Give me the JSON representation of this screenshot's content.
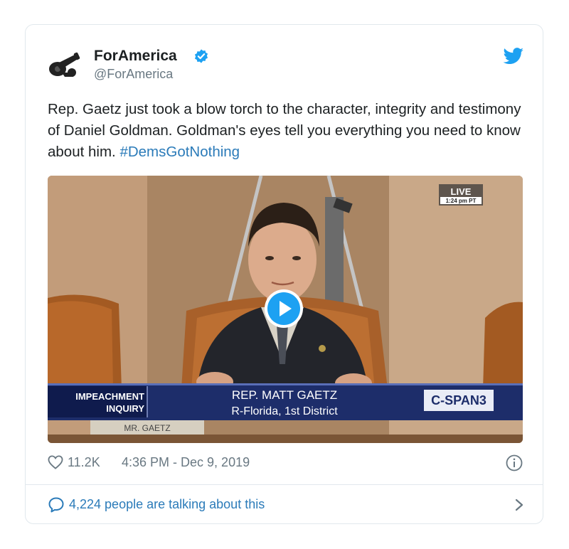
{
  "tweet": {
    "author_name": "ForAmerica",
    "author_handle": "@ForAmerica",
    "text_main": "Rep. Gaetz just took a blow torch to the character, integrity and testimony of Daniel Goldman. Goldman's eyes tell you everything you need to know about him.",
    "hashtag": "#DemsGotNothing",
    "likes": "11.2K",
    "timestamp": "4:36 PM - Dec 9, 2019",
    "talking": "4,224 people are talking about this"
  },
  "video": {
    "live_label": "LIVE",
    "live_time": "1:24 pm PT",
    "chyron_left_1": "IMPEACHMENT",
    "chyron_left_2": "INQUIRY",
    "chyron_name": "REP. MATT GAETZ",
    "chyron_district": "R-Florida, 1st District",
    "network_logo": "C-SPAN3",
    "nameplate": "MR. GAETZ"
  },
  "colors": {
    "link": "#2b7bb9",
    "muted": "#697882",
    "twitter_blue": "#1da1f2",
    "border": "#e1e8ed"
  },
  "icons": [
    "cannon-avatar-icon",
    "verified-icon",
    "twitter-bird-icon",
    "play-icon",
    "heart-icon",
    "info-icon",
    "comment-bubble-icon",
    "chevron-right-icon"
  ]
}
